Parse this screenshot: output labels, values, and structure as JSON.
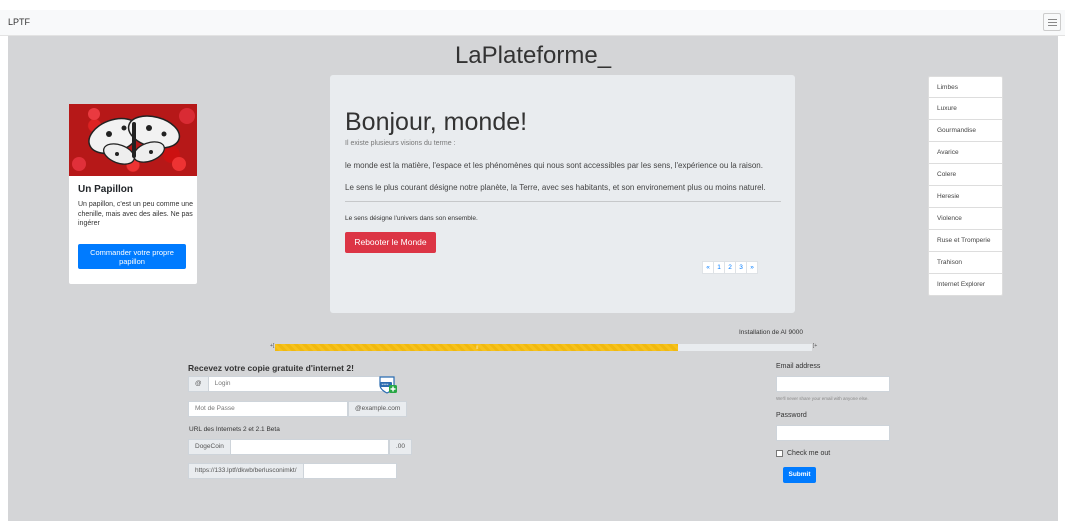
{
  "navbar": {
    "brand": "LPTF",
    "toggler_icon": "hamburger-icon"
  },
  "site_title": "LaPlateforme_",
  "card": {
    "image_alt": "butterfly on red flowers",
    "title": "Un Papillon",
    "text": "Un papillon, c'est un peu comme une chenille, mais avec des ailes. Ne pas ingérer",
    "button": "Commander votre propre papillon"
  },
  "jumbotron": {
    "heading": "Bonjour, monde!",
    "intro": "Il existe plusieurs visions du terme :",
    "lead1": "le monde est la matière, l'espace et les phénomènes qui nous sont accessibles par les sens, l'expérience ou la raison.",
    "lead2": "Le sens le plus courant désigne notre planète, la Terre, avec ses habitants, et son environement plus ou moins naturel.",
    "small": "Le sens désigne l'univers dans son ensemble.",
    "button": "Rebooter le Monde",
    "pagination": [
      "«",
      "1",
      "2",
      "3",
      "»"
    ]
  },
  "sidebar": {
    "items": [
      "Limbes",
      "Luxure",
      "Gourmandise",
      "Avarice",
      "Colere",
      "Heresie",
      "Violence",
      "Ruse et Tromperie",
      "Trahison",
      "Internet Explorer"
    ]
  },
  "progress": {
    "label": "Installation de AI 9000",
    "value": 0.75,
    "start_marker": "+[",
    "end_marker": "]+",
    "bar_text": "||"
  },
  "left_form": {
    "title": "Recevez votre copie gratuite d'internet 2!",
    "login_prefix": "@",
    "login_placeholder": "Login",
    "password_placeholder": "Mot de Passe",
    "email_suffix": "@example.com",
    "url_label": "URL des Internets 2 et 2.1 Beta",
    "coin_prefix": "DogeCoin",
    "coin_suffix": ".00",
    "url_prefix": "https://133.lptf/dkwb/berlusconimkt/"
  },
  "right_form": {
    "email_label": "Email address",
    "email_help": "We'll never share your email with anyone else.",
    "password_label": "Password",
    "checkbox_label": "Check me out",
    "submit": "Submit"
  },
  "colors": {
    "primary": "#007bff",
    "danger": "#dc3545",
    "progress": "#f0b910",
    "background": "#d4d5d7"
  }
}
